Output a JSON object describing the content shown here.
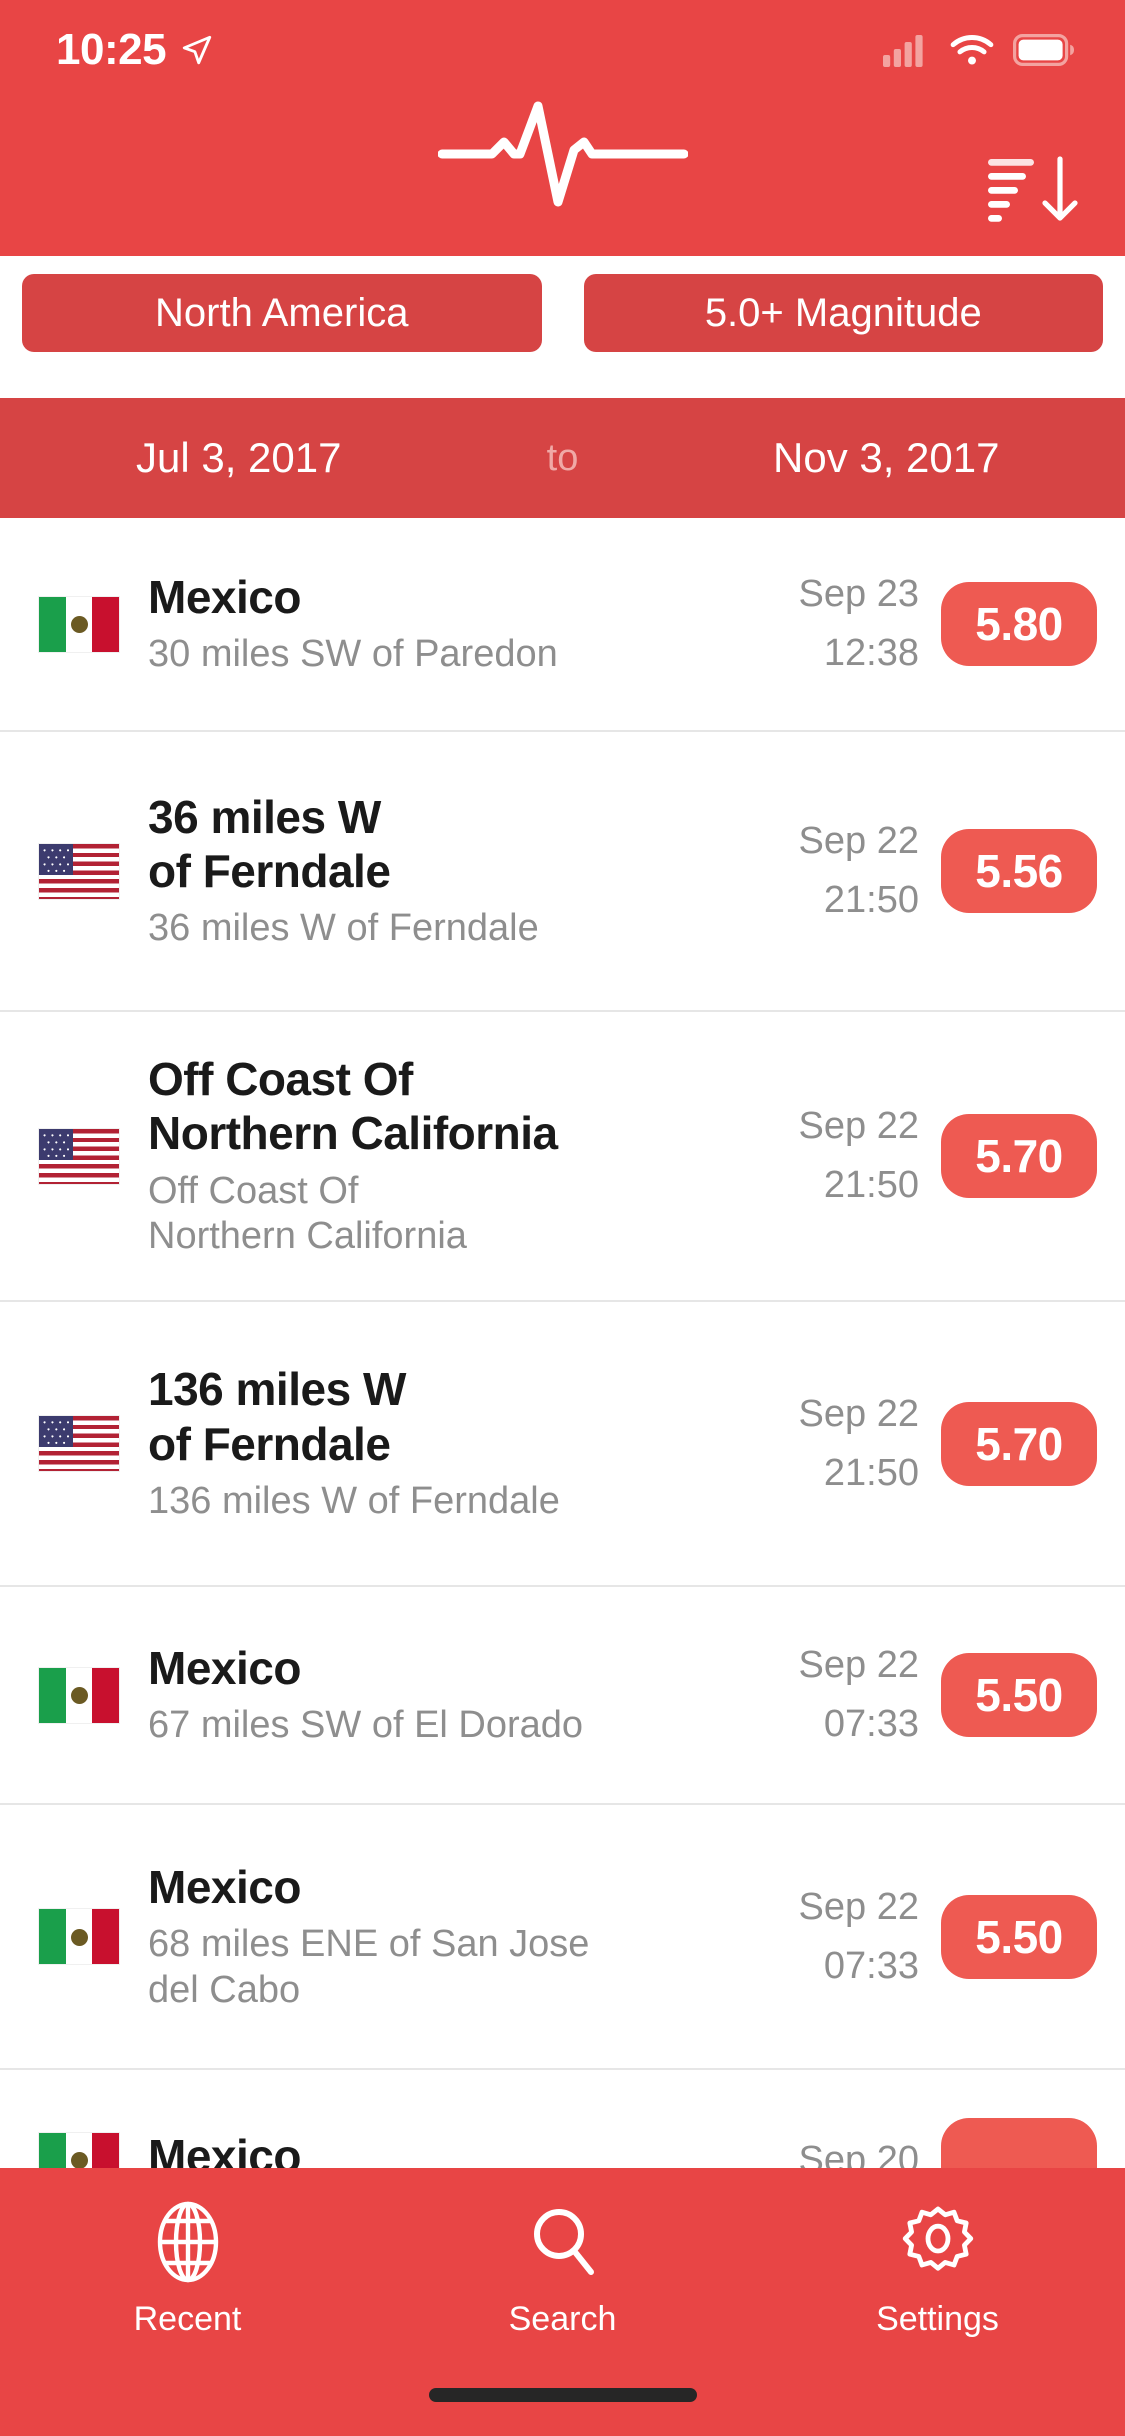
{
  "theme": {
    "header_red": "#e84545",
    "pill_red": "#d64444",
    "badge_red": "#ee5a52",
    "text_dark": "#1a1a1a",
    "text_muted": "#8e8e8e"
  },
  "status_bar": {
    "time": "10:25",
    "location_icon": "location-arrow-icon",
    "cellular_icon": "cellular-signal-icon",
    "wifi_icon": "wifi-icon",
    "battery_icon": "battery-icon"
  },
  "header": {
    "logo_icon": "pulse-waveform-icon",
    "sort_icon": "sort-descending-icon"
  },
  "filters": [
    {
      "label": "North America",
      "name": "region-filter"
    },
    {
      "label": "5.0+ Magnitude",
      "name": "magnitude-filter"
    }
  ],
  "date_range": {
    "from": "Jul 3, 2017",
    "separator": "to",
    "to": "Nov 3, 2017"
  },
  "list": [
    {
      "flag": "mx",
      "flag_name": "flag-mexico-icon",
      "title": "Mexico",
      "subtitle": "30 miles SW of Paredon",
      "date": "Sep 23",
      "time": "12:38",
      "magnitude": "5.80"
    },
    {
      "flag": "us",
      "flag_name": "flag-united-states-icon",
      "title": "36 miles W\nof Ferndale",
      "subtitle": "36 miles W of Ferndale",
      "date": "Sep 22",
      "time": "21:50",
      "magnitude": "5.56"
    },
    {
      "flag": "us",
      "flag_name": "flag-united-states-icon",
      "title": "Off Coast Of\nNorthern California",
      "subtitle": "Off Coast Of\nNorthern California",
      "date": "Sep 22",
      "time": "21:50",
      "magnitude": "5.70"
    },
    {
      "flag": "us",
      "flag_name": "flag-united-states-icon",
      "title": "136 miles W\nof Ferndale",
      "subtitle": "136 miles W of Ferndale",
      "date": "Sep 22",
      "time": "21:50",
      "magnitude": "5.70"
    },
    {
      "flag": "mx",
      "flag_name": "flag-mexico-icon",
      "title": "Mexico",
      "subtitle": "67 miles SW of El Dorado",
      "date": "Sep 22",
      "time": "07:33",
      "magnitude": "5.50"
    },
    {
      "flag": "mx",
      "flag_name": "flag-mexico-icon",
      "title": "Mexico",
      "subtitle": "68 miles ENE of San Jose\ndel Cabo",
      "date": "Sep 22",
      "time": "07:33",
      "magnitude": "5.50"
    },
    {
      "flag": "mx",
      "flag_name": "flag-mexico-icon",
      "title": "Mexico",
      "subtitle": "",
      "date": "Sep 20",
      "time": "",
      "magnitude": ""
    }
  ],
  "tabs": [
    {
      "label": "Recent",
      "icon": "globe-icon",
      "name": "tab-recent",
      "active": true
    },
    {
      "label": "Search",
      "icon": "search-icon",
      "name": "tab-search",
      "active": false
    },
    {
      "label": "Settings",
      "icon": "gear-icon",
      "name": "tab-settings",
      "active": false
    }
  ]
}
